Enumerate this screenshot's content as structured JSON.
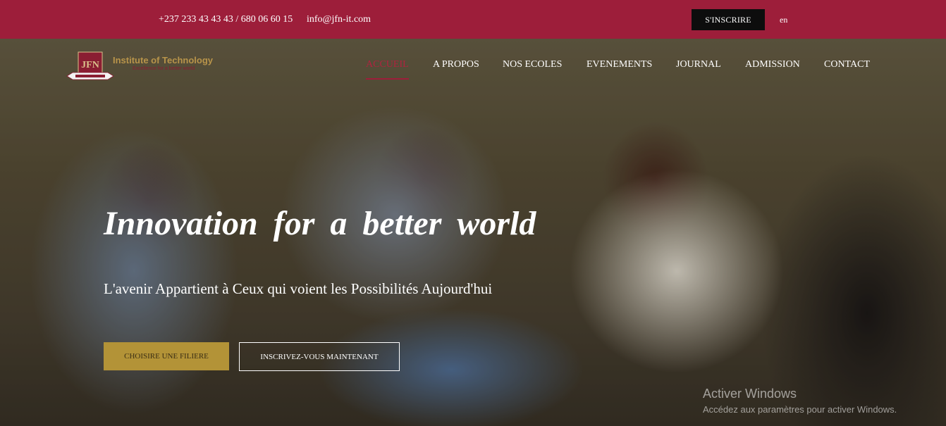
{
  "topbar": {
    "phone": "+237 233 43 43 43 / 680 06 60 15",
    "email": "info@jfn-it.com",
    "signup_label": "S'INSCRIRE",
    "language": "en"
  },
  "logo": {
    "monogram": "JFN",
    "brand": "Institute of Technology",
    "tagline": "Excellence for a better world"
  },
  "nav": {
    "items": [
      {
        "label": "ACCUEIL",
        "active": true
      },
      {
        "label": "A PROPOS",
        "active": false
      },
      {
        "label": "NOS ECOLES",
        "active": false
      },
      {
        "label": "EVENEMENTS",
        "active": false
      },
      {
        "label": "JOURNAL",
        "active": false
      },
      {
        "label": "ADMISSION",
        "active": false
      },
      {
        "label": "CONTACT",
        "active": false
      }
    ]
  },
  "hero": {
    "headline": "Innovation for a better world",
    "subline": "L'avenir Appartient à Ceux qui voient les Possibilités Aujourd'hui",
    "primary_button": "CHOISIRE UNE FILIERE",
    "secondary_button": "INSCRIVEZ-VOUS MAINTENANT"
  },
  "watermark": {
    "title": "Activer Windows",
    "subtitle": "Accédez aux paramètres pour activer Windows."
  },
  "colors": {
    "brand_red": "#9d1e3a",
    "gold": "#b39337",
    "dark": "#0d0d0d"
  }
}
